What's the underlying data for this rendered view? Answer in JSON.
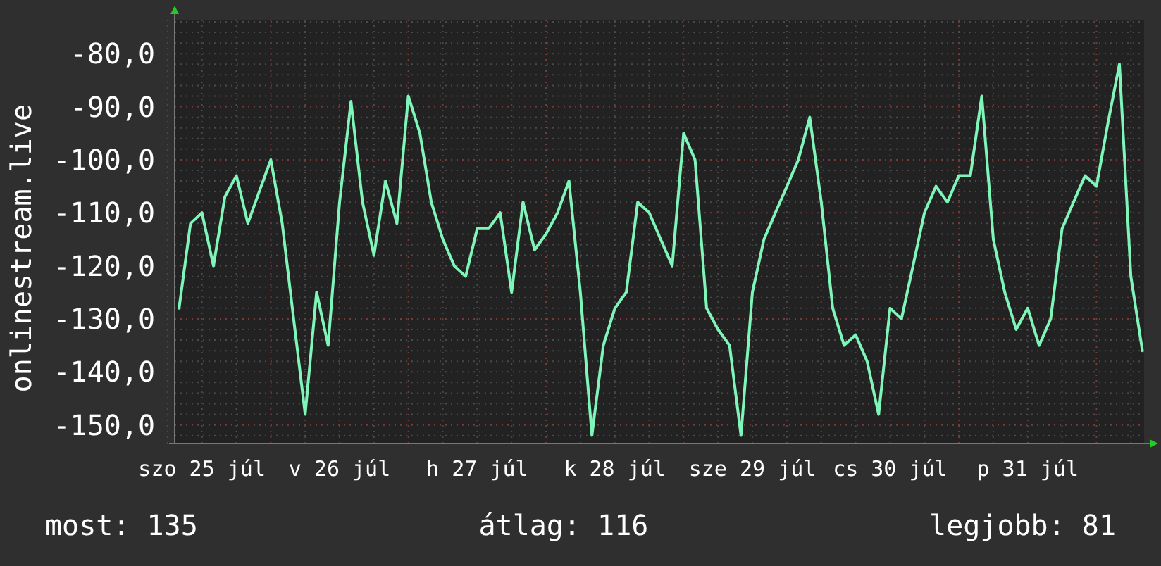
{
  "chart": {
    "chart_data": {
      "type": "line",
      "grid": true,
      "categories": [
        null,
        null,
        "szo 25 júl",
        null,
        null,
        null,
        null,
        null,
        null,
        null,
        null,
        null,
        null,
        null,
        "v 26 júl",
        null,
        null,
        null,
        null,
        null,
        null,
        null,
        null,
        null,
        null,
        null,
        "h 27 júl",
        null,
        null,
        null,
        null,
        null,
        null,
        null,
        null,
        null,
        null,
        null,
        "k 28 júl",
        null,
        null,
        null,
        null,
        null,
        null,
        null,
        null,
        null,
        null,
        null,
        "sze 29 júl",
        null,
        null,
        null,
        null,
        null,
        null,
        null,
        null,
        null,
        null,
        null,
        "cs 30 júl",
        null,
        null,
        null,
        null,
        null,
        null,
        null,
        null,
        null,
        null,
        null,
        "p 31 júl",
        null,
        null,
        null,
        null,
        null,
        null,
        null,
        null,
        null,
        null
      ],
      "series": [
        {
          "name": "onlinestream.live",
          "color": "#7ff5b9",
          "values": [
            -128,
            -112,
            -110,
            -120,
            -107,
            -103,
            -112,
            -106,
            -100,
            -112,
            -130,
            -148,
            -125,
            -135,
            -108,
            -89,
            -108,
            -118,
            -104,
            -112,
            -88,
            -95,
            -108,
            -115,
            -120,
            -122,
            -113,
            -113,
            -110,
            -125,
            -108,
            -117,
            -114,
            -110,
            -104,
            -125,
            -152,
            -135,
            -128,
            -125,
            -108,
            -110,
            -115,
            -120,
            -95,
            -100,
            -128,
            -132,
            -135,
            -152,
            -125,
            -115,
            -110,
            -105,
            -100,
            -92,
            -108,
            -128,
            -135,
            -133,
            -138,
            -148,
            -128,
            -130,
            -120,
            -110,
            -105,
            -108,
            -103,
            -103,
            -88,
            -115,
            -125,
            -132,
            -128,
            -135,
            -130,
            -113,
            -108,
            -103,
            -105,
            -93,
            -82,
            -122,
            -136
          ]
        }
      ],
      "ylim": [
        -153.5,
        -73.6
      ],
      "yticks": [
        {
          "value": -80,
          "label": "-80,0"
        },
        {
          "value": -90,
          "label": "-90,0"
        },
        {
          "value": -100,
          "label": "-100,0"
        },
        {
          "value": -110,
          "label": "-110,0"
        },
        {
          "value": -120,
          "label": "-120,0"
        },
        {
          "value": -130,
          "label": "-130,0"
        },
        {
          "value": -140,
          "label": "-140,0"
        },
        {
          "value": -150,
          "label": "-150,0"
        }
      ]
    }
  },
  "stats": [
    "most: 135",
    "átlag: 116",
    "legjobb: 81"
  ]
}
